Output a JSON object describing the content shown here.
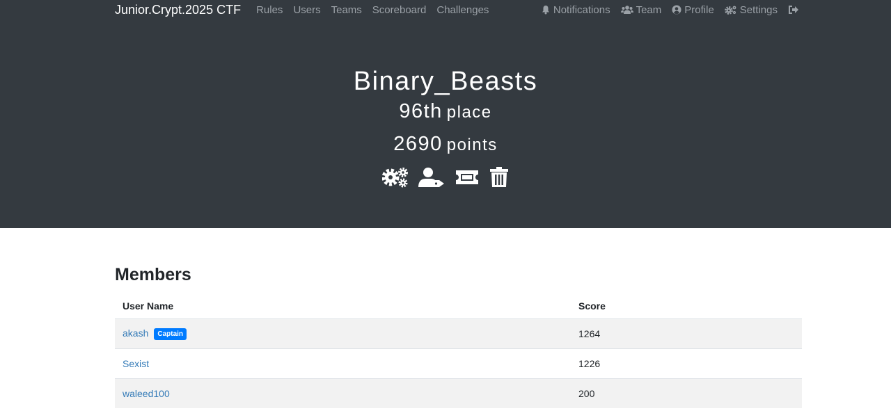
{
  "navbar": {
    "brand": "Junior.Crypt.2025 CTF",
    "left_links": [
      "Rules",
      "Users",
      "Teams",
      "Scoreboard",
      "Challenges"
    ],
    "right_links": [
      {
        "label": "Notifications",
        "icon": "bell-icon"
      },
      {
        "label": "Team",
        "icon": "users-icon"
      },
      {
        "label": "Profile",
        "icon": "user-circle-icon"
      },
      {
        "label": "Settings",
        "icon": "cogs-icon"
      }
    ],
    "logout_icon": "sign-out-icon"
  },
  "team": {
    "name": "Binary_Beasts",
    "place_value": "96th",
    "place_word": "place",
    "points_value": "2690",
    "points_word": "points",
    "actions": [
      "cogs-icon",
      "user-tag-icon",
      "ticket-icon",
      "trash-icon"
    ]
  },
  "members": {
    "title": "Members",
    "columns": [
      "User Name",
      "Score"
    ],
    "rows": [
      {
        "name": "akash",
        "badge": "Captain",
        "score": "1264"
      },
      {
        "name": "Sexist",
        "badge": "",
        "score": "1226"
      },
      {
        "name": "waleed100",
        "badge": "",
        "score": "200"
      }
    ]
  },
  "colors": {
    "header_bg": "#343a40",
    "link": "#337ab7",
    "badge": "#007bff",
    "row_stripe": "#f2f2f2"
  }
}
